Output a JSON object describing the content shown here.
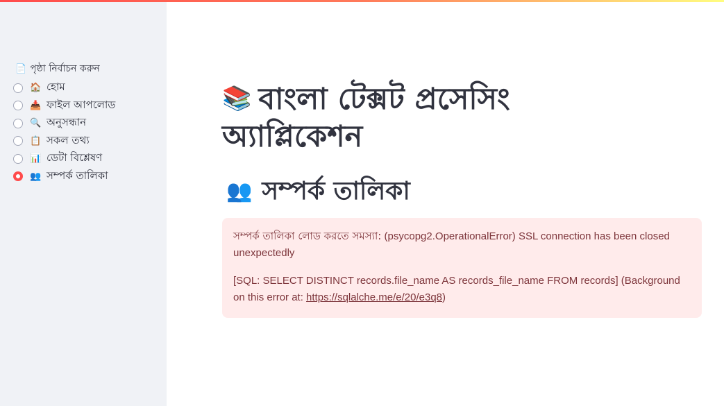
{
  "sidebar": {
    "radio_label": "পৃষ্ঠা নির্বাচন করুন",
    "radio_label_icon": "📄",
    "options": [
      {
        "icon": "🏠",
        "label": "হোম",
        "selected": false
      },
      {
        "icon": "📥",
        "label": "ফাইল আপলোড",
        "selected": false
      },
      {
        "icon": "🔍",
        "label": "অনুসন্ধান",
        "selected": false
      },
      {
        "icon": "📋",
        "label": "সকল তথ্য",
        "selected": false
      },
      {
        "icon": "📊",
        "label": "ডেটা বিশ্লেষণ",
        "selected": false
      },
      {
        "icon": "👥",
        "label": "সম্পর্ক তালিকা",
        "selected": true
      }
    ]
  },
  "main": {
    "title_icon": "📚",
    "title": "বাংলা টেক্সট প্রসেসিং অ্যাপ্লিকেশন",
    "subheader_icon": "👥",
    "subheader": "সম্পর্ক তালিকা",
    "error": {
      "prefix": "সম্পর্ক তালিকা লোড করতে সমস্যা:",
      "message": " (psycopg2.OperationalError) SSL connection has been closed unexpectedly",
      "sql_text": "[SQL: SELECT DISTINCT records.file_name AS records_file_name FROM records] (Background on this error at: ",
      "link_text": "https://sqlalche.me/e/20/e3q8",
      "suffix": ")"
    }
  },
  "colors": {
    "accent": "#ff4b4b",
    "sidebar_bg": "#f0f2f6",
    "error_bg": "#ffebeb",
    "error_text": "#7d353b",
    "text": "#31333f"
  }
}
